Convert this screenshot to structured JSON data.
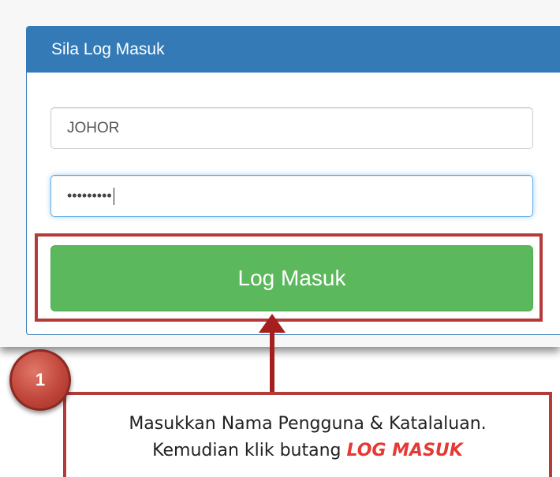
{
  "panel": {
    "heading": "Sila Log Masuk"
  },
  "form": {
    "username_value": "JOHOR",
    "password_value": "•••••••••",
    "login_label": "Log Masuk"
  },
  "annotation": {
    "step_number": "1",
    "instruction_line1": "Masukkan Nama Pengguna & Katalaluan.",
    "instruction_line2_prefix": "Kemudian klik butang ",
    "instruction_line2_emphasis": "LOG MASUK",
    "colors": {
      "highlight": "#b53a3a",
      "arrow": "#a51f1f",
      "emphasis_text": "#e53935"
    }
  },
  "colors": {
    "panel_heading": "#337ab7",
    "login_button": "#5cb85c"
  }
}
